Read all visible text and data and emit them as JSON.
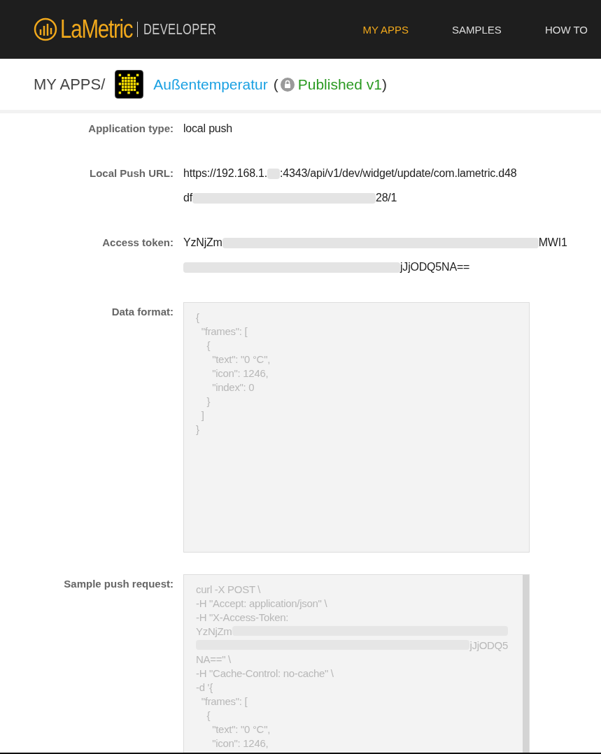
{
  "header": {
    "logo_text": "LaMetric",
    "logo_suffix": "DEVELOPER",
    "nav": [
      {
        "label": "MY APPS",
        "selected": true
      },
      {
        "label": "SAMPLES",
        "selected": false
      },
      {
        "label": "HOW TO",
        "selected": false
      }
    ]
  },
  "breadcrumb": {
    "root": "MY APPS/",
    "app_name": "Außentemperatur",
    "open_paren": "(",
    "status": "Published v1",
    "close_paren": ")"
  },
  "fields": [
    {
      "label": "Application type:",
      "kind": "text",
      "lines": [
        [
          {
            "kind": "text",
            "text": "local push"
          }
        ]
      ]
    },
    {
      "label": "Local Push URL:",
      "kind": "text",
      "lines": [
        [
          {
            "kind": "text",
            "text": "https://192.168.1."
          },
          {
            "kind": "blur-short"
          },
          {
            "kind": "text",
            "text": ":4343/api/v1/dev/widget/update/com.lametric.d48"
          }
        ],
        [
          {
            "kind": "text",
            "text": "df"
          },
          {
            "kind": "blur-medium"
          },
          {
            "kind": "text",
            "text": "28/1"
          }
        ]
      ]
    },
    {
      "label": "Access token:",
      "kind": "text",
      "lines": [
        [
          {
            "kind": "text",
            "text": "YzNjZm"
          },
          {
            "kind": "blur-full"
          },
          {
            "kind": "text",
            "text": "MWI1"
          }
        ],
        [
          {
            "kind": "blur-wide"
          },
          {
            "kind": "text",
            "text": "jJjODQ5NA=="
          }
        ]
      ]
    },
    {
      "label": "Data format:",
      "kind": "code",
      "lines": [
        [
          {
            "kind": "text",
            "text": "{"
          }
        ],
        [
          {
            "kind": "text",
            "text": "  \"frames\": ["
          }
        ],
        [
          {
            "kind": "text",
            "text": "    {"
          }
        ],
        [
          {
            "kind": "text",
            "text": "      \"text\": \"0 °C\","
          }
        ],
        [
          {
            "kind": "text",
            "text": "      \"icon\": 1246,"
          }
        ],
        [
          {
            "kind": "text",
            "text": "      \"index\": 0"
          }
        ],
        [
          {
            "kind": "text",
            "text": "    }"
          }
        ],
        [
          {
            "kind": "text",
            "text": "  ]"
          }
        ],
        [
          {
            "kind": "text",
            "text": "}"
          }
        ]
      ]
    },
    {
      "label": "Sample push request:",
      "kind": "scroll-code",
      "lines": [
        [
          {
            "kind": "text",
            "text": "curl -X POST \\"
          }
        ],
        [
          {
            "kind": "text",
            "text": "-H \"Accept: application/json\" \\"
          }
        ],
        [
          {
            "kind": "text",
            "text": "-H \"X-Access-Token:"
          }
        ],
        [
          {
            "kind": "text",
            "text": "YzNjZm"
          },
          {
            "kind": "blur-long"
          }
        ],
        [
          {
            "kind": "blur-full"
          },
          {
            "kind": "text",
            "text": "jJjODQ5"
          }
        ],
        [
          {
            "kind": "text",
            "text": "NA==\" \\"
          }
        ],
        [
          {
            "kind": "text",
            "text": "-H \"Cache-Control: no-cache\" \\"
          }
        ],
        [
          {
            "kind": "text",
            "text": "-d '{"
          }
        ],
        [
          {
            "kind": "text",
            "text": "  \"frames\": ["
          }
        ],
        [
          {
            "kind": "text",
            "text": "    {"
          }
        ],
        [
          {
            "kind": "text",
            "text": "      \"text\": \"0 °C\","
          }
        ],
        [
          {
            "kind": "text",
            "text": "      \"icon\": 1246,"
          }
        ]
      ]
    }
  ]
}
